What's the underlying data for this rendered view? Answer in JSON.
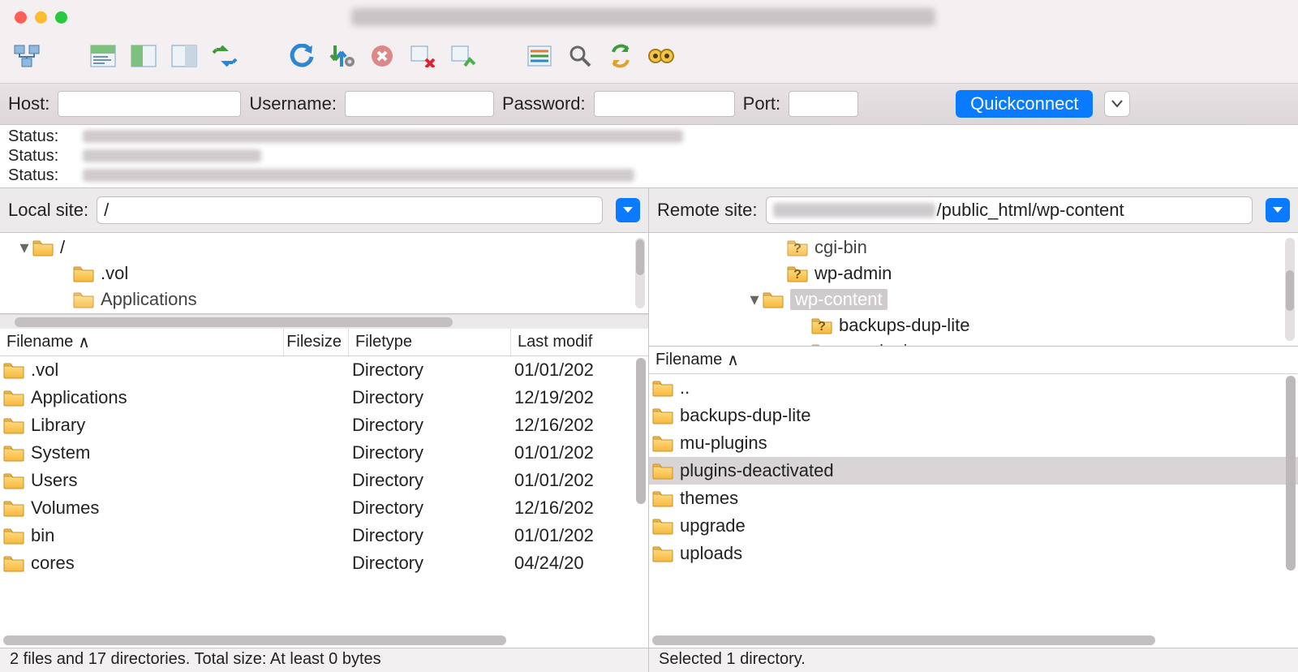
{
  "quickconnect": {
    "host_label": "Host:",
    "user_label": "Username:",
    "pass_label": "Password:",
    "port_label": "Port:",
    "button": "Quickconnect"
  },
  "log": {
    "label": "Status:"
  },
  "local": {
    "site_label": "Local site:",
    "site_value": "/",
    "tree": [
      {
        "indent": 20,
        "chevron": "▾",
        "name": "/",
        "question": false
      },
      {
        "indent": 70,
        "chevron": "",
        "name": ".vol",
        "question": false
      },
      {
        "indent": 70,
        "chevron": "",
        "name": "Applications",
        "question": false,
        "cut": true
      }
    ],
    "columns": {
      "name": "Filename",
      "size": "Filesize",
      "type": "Filetype",
      "mod": "Last modif"
    },
    "rows": [
      {
        "name": ".vol",
        "size": "",
        "type": "Directory",
        "mod": "01/01/202"
      },
      {
        "name": "Applications",
        "size": "",
        "type": "Directory",
        "mod": "12/19/202"
      },
      {
        "name": "Library",
        "size": "",
        "type": "Directory",
        "mod": "12/16/202"
      },
      {
        "name": "System",
        "size": "",
        "type": "Directory",
        "mod": "01/01/202"
      },
      {
        "name": "Users",
        "size": "",
        "type": "Directory",
        "mod": "01/01/202"
      },
      {
        "name": "Volumes",
        "size": "",
        "type": "Directory",
        "mod": "12/16/202"
      },
      {
        "name": "bin",
        "size": "",
        "type": "Directory",
        "mod": "01/01/202"
      },
      {
        "name": "cores",
        "size": "",
        "type": "Directory",
        "mod": "04/24/20"
      }
    ],
    "footer": "2 files and 17 directories. Total size: At least 0 bytes"
  },
  "remote": {
    "site_label": "Remote site:",
    "site_value_suffix": "/public_html/wp-content",
    "tree": [
      {
        "indent": 150,
        "chevron": "",
        "name": "cgi-bin",
        "question": true,
        "cut": true
      },
      {
        "indent": 150,
        "chevron": "",
        "name": "wp-admin",
        "question": true
      },
      {
        "indent": 120,
        "chevron": "▾",
        "name": "wp-content",
        "question": false,
        "selected": true
      },
      {
        "indent": 180,
        "chevron": "",
        "name": "backups-dup-lite",
        "question": true
      },
      {
        "indent": 180,
        "chevron": "",
        "name": "mu-plugins",
        "question": true,
        "cut": true
      }
    ],
    "columns": {
      "name": "Filename"
    },
    "rows": [
      {
        "name": ".."
      },
      {
        "name": "backups-dup-lite"
      },
      {
        "name": "mu-plugins"
      },
      {
        "name": "plugins-deactivated",
        "selected": true
      },
      {
        "name": "themes"
      },
      {
        "name": "upgrade"
      },
      {
        "name": "uploads"
      }
    ],
    "footer": "Selected 1 directory."
  }
}
